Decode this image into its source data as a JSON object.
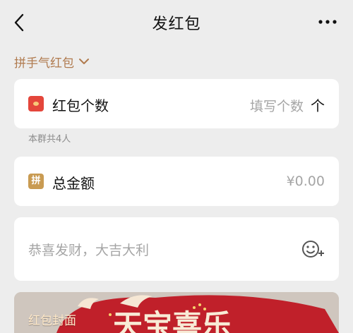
{
  "header": {
    "title": "发红包"
  },
  "packet_type": {
    "label": "拼手气红包"
  },
  "count": {
    "label": "红包个数",
    "placeholder": "填写个数",
    "unit": "个"
  },
  "group_hint": "本群共4人",
  "amount": {
    "badge": "拼",
    "label": "总金额",
    "value": "¥0.00"
  },
  "message": {
    "placeholder": "恭喜发财，大吉大利"
  },
  "cover": {
    "label": "红包封面",
    "art_text": "天宝喜乐"
  },
  "colors": {
    "background": "#EDEDED",
    "accent_brown": "#B07A4E",
    "packet_red": "#E4463B",
    "badge_gold": "#C99B52",
    "cover_red": "#C0202A"
  }
}
